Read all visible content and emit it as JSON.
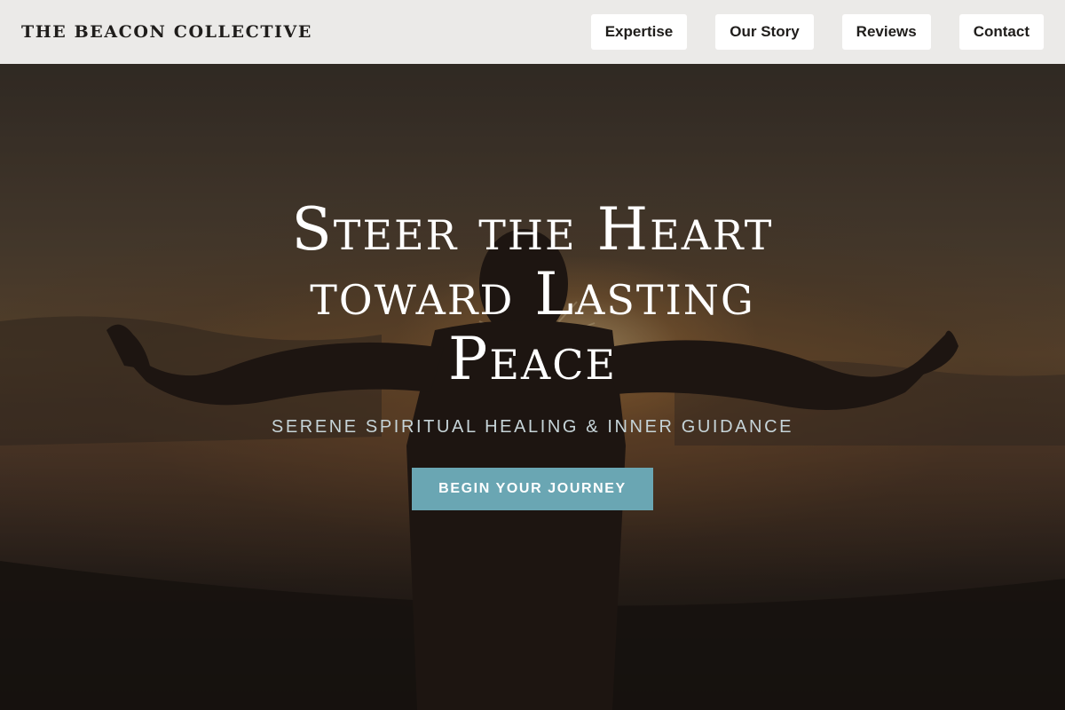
{
  "header": {
    "brand": "THE BEACON COLLECTIVE",
    "nav": [
      {
        "label": "Expertise"
      },
      {
        "label": "Our Story"
      },
      {
        "label": "Reviews"
      },
      {
        "label": "Contact"
      }
    ]
  },
  "hero": {
    "headline": "Steer the Heart toward Lasting Peace",
    "subheadline": "Serene Spiritual Healing & Inner Guidance",
    "cta_label": "Begin Your Journey",
    "background_image": "silhouette of a person with outstretched arms against a sunset"
  },
  "colors": {
    "header_bg": "#ebeae8",
    "cta_bg": "#6aa6b3",
    "subheadline": "#c6d4d8",
    "headline": "#ffffff"
  }
}
